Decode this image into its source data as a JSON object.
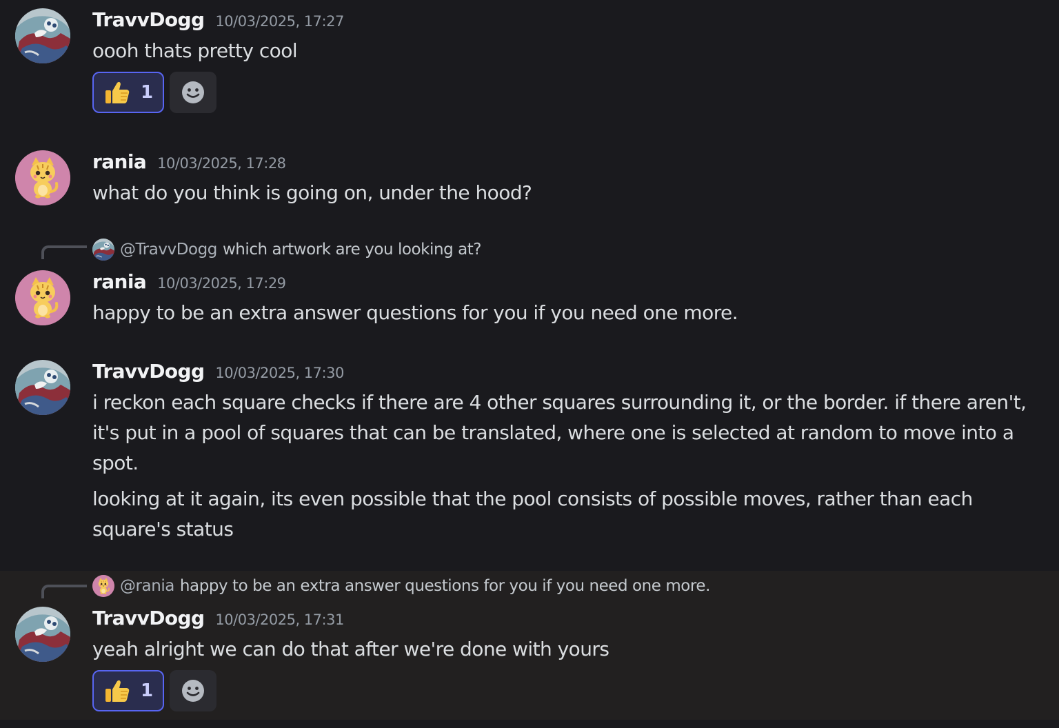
{
  "messages": [
    {
      "author": "TravvDogg",
      "timestamp": "10/03/2025, 17:27",
      "lines": [
        "oooh thats pretty cool"
      ],
      "reaction": {
        "emoji": "thumbs-up",
        "count": "1"
      }
    },
    {
      "author": "rania",
      "timestamp": "10/03/2025, 17:28",
      "lines": [
        "what do you think is going on, under the hood?"
      ]
    },
    {
      "author": "rania",
      "timestamp": "10/03/2025, 17:29",
      "reply_to": {
        "mention": "@TravvDogg",
        "preview": "which artwork are you looking at?"
      },
      "lines": [
        "happy to be an extra answer questions for you if you need one more."
      ]
    },
    {
      "author": "TravvDogg",
      "timestamp": "10/03/2025, 17:30",
      "lines": [
        "i reckon each square checks if there are 4 other squares surrounding it, or the border. if there aren't, it's put in a pool of squares that can be translated, where one is selected at random to move into a spot.",
        "looking at it again, its even possible that the pool consists of possible moves, rather than each square's status"
      ]
    },
    {
      "author": "TravvDogg",
      "timestamp": "10/03/2025, 17:31",
      "reply_to": {
        "mention": "@rania",
        "preview": "happy to be an extra answer questions for you if you need one more."
      },
      "lines": [
        "yeah alright we can do that after we're done with yours"
      ],
      "reaction": {
        "emoji": "thumbs-up",
        "count": "1"
      }
    }
  ],
  "icons": {
    "reaction_emoji": "thumbs-up-icon",
    "add_reaction": "smiley-face-icon"
  },
  "colors": {
    "background": "#1a1a1e",
    "highlight_background": "#222020",
    "reaction_border": "#5865f2",
    "reaction_bg": "#2a2d4e"
  }
}
